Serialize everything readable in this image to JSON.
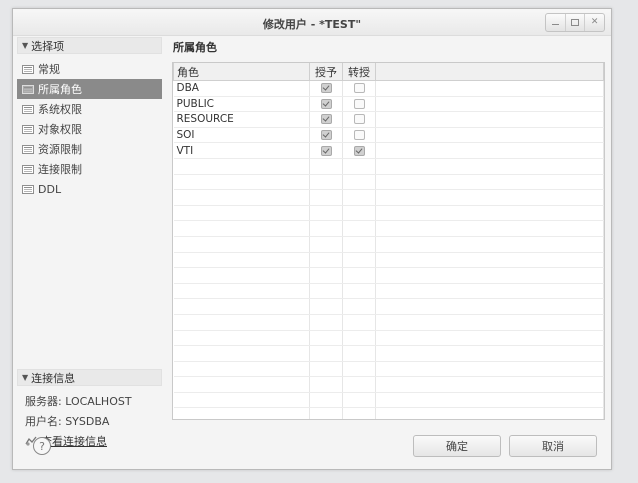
{
  "window": {
    "title": "修改用户 - *TEST\""
  },
  "nav": {
    "section_title": "选择项",
    "items": [
      {
        "label": "常规",
        "selected": false
      },
      {
        "label": "所属角色",
        "selected": true
      },
      {
        "label": "系统权限",
        "selected": false
      },
      {
        "label": "对象权限",
        "selected": false
      },
      {
        "label": "资源限制",
        "selected": false
      },
      {
        "label": "连接限制",
        "selected": false
      },
      {
        "label": "DDL",
        "selected": false
      }
    ]
  },
  "connection": {
    "section_title": "连接信息",
    "server_label": "服务器: LOCALHOST",
    "user_label": "用户名: SYSDBA",
    "view_link": "查看连接信息"
  },
  "panel": {
    "title": "所属角色",
    "columns": [
      "角色",
      "授予",
      "转授"
    ],
    "rows": [
      {
        "role": "DBA",
        "grant": true,
        "regrant": false
      },
      {
        "role": "PUBLIC",
        "grant": true,
        "regrant": false
      },
      {
        "role": "RESOURCE",
        "grant": true,
        "regrant": false
      },
      {
        "role": "SOI",
        "grant": true,
        "regrant": false
      },
      {
        "role": "VTI",
        "grant": true,
        "regrant": true
      }
    ],
    "empty_rows": 17
  },
  "footer": {
    "ok_label": "确定",
    "cancel_label": "取消"
  }
}
